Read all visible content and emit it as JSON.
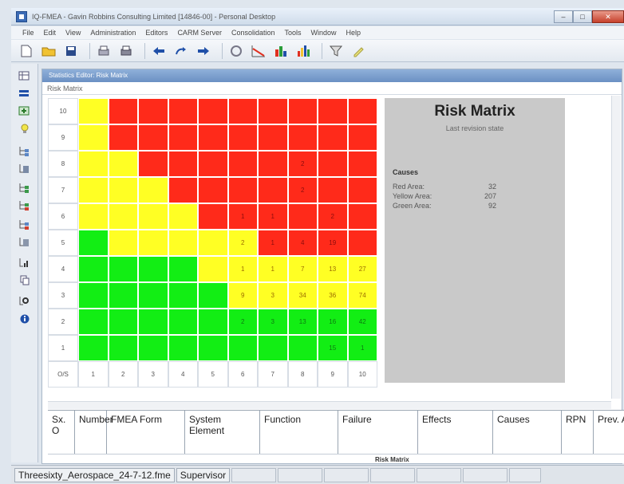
{
  "window": {
    "title": "IQ-FMEA - Gavin Robbins Consulting Limited [14846-00] - Personal Desktop",
    "controls": {
      "minimize": "–",
      "maximize": "□",
      "close": "✕"
    }
  },
  "menu": [
    "File",
    "Edit",
    "View",
    "Administration",
    "Editors",
    "CARM Server",
    "Consolidation",
    "Tools",
    "Window",
    "Help"
  ],
  "toolbar": {
    "icons": [
      "new-document-icon",
      "open-folder-icon",
      "save-icon",
      "print-preview-icon",
      "print-icon",
      "back-arrow-icon",
      "redo-icon",
      "forward-arrow-icon",
      "report-icon",
      "chart-line-icon",
      "chart-mixed-icon",
      "chart-bar-icon",
      "filter-icon",
      "highlight-icon"
    ]
  },
  "left_toolbar": {
    "icons": [
      "table-icon",
      "minus-bar-icon",
      "add-row-icon",
      "lightbulb-icon",
      "tree-branch-icon",
      "tree-list-icon",
      "tree-node-icon",
      "tree-expand-icon",
      "tree-collapse-icon",
      "tree-table-icon",
      "tree-chart-icon",
      "tree-copy-icon",
      "tree-search-icon",
      "info-icon"
    ]
  },
  "editor": {
    "header": "Statistics Editor: Risk Matrix",
    "subheader": "Risk Matrix"
  },
  "matrix": {
    "corner_label": "O/S",
    "columns": [
      "1",
      "2",
      "3",
      "4",
      "5",
      "6",
      "7",
      "8",
      "9",
      "10"
    ],
    "rows": [
      {
        "label": "10",
        "cells": [
          {
            "color": "yellow",
            "value": ""
          },
          {
            "color": "red",
            "value": ""
          },
          {
            "color": "red",
            "value": ""
          },
          {
            "color": "red",
            "value": ""
          },
          {
            "color": "red",
            "value": ""
          },
          {
            "color": "red",
            "value": ""
          },
          {
            "color": "red",
            "value": ""
          },
          {
            "color": "red",
            "value": ""
          },
          {
            "color": "red",
            "value": ""
          },
          {
            "color": "red",
            "value": ""
          }
        ]
      },
      {
        "label": "9",
        "cells": [
          {
            "color": "yellow",
            "value": ""
          },
          {
            "color": "red",
            "value": ""
          },
          {
            "color": "red",
            "value": ""
          },
          {
            "color": "red",
            "value": ""
          },
          {
            "color": "red",
            "value": ""
          },
          {
            "color": "red",
            "value": ""
          },
          {
            "color": "red",
            "value": ""
          },
          {
            "color": "red",
            "value": ""
          },
          {
            "color": "red",
            "value": ""
          },
          {
            "color": "red",
            "value": ""
          }
        ]
      },
      {
        "label": "8",
        "cells": [
          {
            "color": "yellow",
            "value": ""
          },
          {
            "color": "yellow",
            "value": ""
          },
          {
            "color": "red",
            "value": ""
          },
          {
            "color": "red",
            "value": ""
          },
          {
            "color": "red",
            "value": ""
          },
          {
            "color": "red",
            "value": ""
          },
          {
            "color": "red",
            "value": ""
          },
          {
            "color": "red",
            "value": "2"
          },
          {
            "color": "red",
            "value": ""
          },
          {
            "color": "red",
            "value": ""
          }
        ]
      },
      {
        "label": "7",
        "cells": [
          {
            "color": "yellow",
            "value": ""
          },
          {
            "color": "yellow",
            "value": ""
          },
          {
            "color": "yellow",
            "value": ""
          },
          {
            "color": "red",
            "value": ""
          },
          {
            "color": "red",
            "value": ""
          },
          {
            "color": "red",
            "value": ""
          },
          {
            "color": "red",
            "value": ""
          },
          {
            "color": "red",
            "value": "2"
          },
          {
            "color": "red",
            "value": ""
          },
          {
            "color": "red",
            "value": ""
          }
        ]
      },
      {
        "label": "6",
        "cells": [
          {
            "color": "yellow",
            "value": ""
          },
          {
            "color": "yellow",
            "value": ""
          },
          {
            "color": "yellow",
            "value": ""
          },
          {
            "color": "yellow",
            "value": ""
          },
          {
            "color": "red",
            "value": ""
          },
          {
            "color": "red",
            "value": "1"
          },
          {
            "color": "red",
            "value": "1"
          },
          {
            "color": "red",
            "value": ""
          },
          {
            "color": "red",
            "value": "2"
          },
          {
            "color": "red",
            "value": ""
          }
        ]
      },
      {
        "label": "5",
        "cells": [
          {
            "color": "green",
            "value": ""
          },
          {
            "color": "yellow",
            "value": ""
          },
          {
            "color": "yellow",
            "value": ""
          },
          {
            "color": "yellow",
            "value": ""
          },
          {
            "color": "yellow",
            "value": ""
          },
          {
            "color": "yellow",
            "value": "2"
          },
          {
            "color": "red",
            "value": "1"
          },
          {
            "color": "red",
            "value": "4"
          },
          {
            "color": "red",
            "value": "19"
          },
          {
            "color": "red",
            "value": ""
          }
        ]
      },
      {
        "label": "4",
        "cells": [
          {
            "color": "green",
            "value": ""
          },
          {
            "color": "green",
            "value": ""
          },
          {
            "color": "green",
            "value": ""
          },
          {
            "color": "green",
            "value": ""
          },
          {
            "color": "yellow",
            "value": ""
          },
          {
            "color": "yellow",
            "value": "1"
          },
          {
            "color": "yellow",
            "value": "1"
          },
          {
            "color": "yellow",
            "value": "7"
          },
          {
            "color": "yellow",
            "value": "13"
          },
          {
            "color": "yellow",
            "value": "27"
          }
        ]
      },
      {
        "label": "3",
        "cells": [
          {
            "color": "green",
            "value": ""
          },
          {
            "color": "green",
            "value": ""
          },
          {
            "color": "green",
            "value": ""
          },
          {
            "color": "green",
            "value": ""
          },
          {
            "color": "green",
            "value": ""
          },
          {
            "color": "yellow",
            "value": "9"
          },
          {
            "color": "yellow",
            "value": "3"
          },
          {
            "color": "yellow",
            "value": "34"
          },
          {
            "color": "yellow",
            "value": "36"
          },
          {
            "color": "yellow",
            "value": "74"
          }
        ]
      },
      {
        "label": "2",
        "cells": [
          {
            "color": "green",
            "value": ""
          },
          {
            "color": "green",
            "value": ""
          },
          {
            "color": "green",
            "value": ""
          },
          {
            "color": "green",
            "value": ""
          },
          {
            "color": "green",
            "value": ""
          },
          {
            "color": "green",
            "value": "2"
          },
          {
            "color": "green",
            "value": "3"
          },
          {
            "color": "green",
            "value": "13"
          },
          {
            "color": "green",
            "value": "16"
          },
          {
            "color": "green",
            "value": "42"
          }
        ]
      },
      {
        "label": "1",
        "cells": [
          {
            "color": "green",
            "value": ""
          },
          {
            "color": "green",
            "value": ""
          },
          {
            "color": "green",
            "value": ""
          },
          {
            "color": "green",
            "value": ""
          },
          {
            "color": "green",
            "value": ""
          },
          {
            "color": "green",
            "value": ""
          },
          {
            "color": "green",
            "value": ""
          },
          {
            "color": "green",
            "value": ""
          },
          {
            "color": "green",
            "value": "15"
          },
          {
            "color": "green",
            "value": "1"
          }
        ]
      }
    ]
  },
  "info": {
    "title": "Risk Matrix",
    "subtitle": "Last revision state",
    "section": "Causes",
    "rows": [
      {
        "label": "Red Area:",
        "value": "32"
      },
      {
        "label": "Yellow Area:",
        "value": "207"
      },
      {
        "label": "Green Area:",
        "value": "92"
      }
    ]
  },
  "table": {
    "headers": [
      "Sx. O",
      "Number",
      "FMEA Form",
      "System Element",
      "Function",
      "Failure",
      "Effects",
      "Causes",
      "RPN",
      "Prev. Acti"
    ],
    "footer_label": "Risk Matrix"
  },
  "status": {
    "project": "Threesixty_Aerospace_24-7-12.fme",
    "role": "Supervisor"
  },
  "colors": {
    "red": "#ff2a1a",
    "yellow": "#ffff24",
    "green": "#12ee14"
  }
}
